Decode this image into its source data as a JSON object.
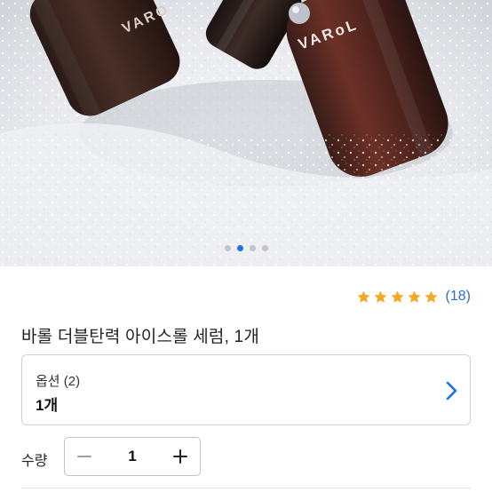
{
  "hero": {
    "brand_left": "VARO",
    "brand_right": "VARoL",
    "carousel": {
      "total": 4,
      "active_index": 1
    }
  },
  "rating": {
    "stars": 5,
    "max_stars": 5,
    "count": "(18)",
    "star_color": "#f5a623"
  },
  "product": {
    "title": "바롤 더블탄력 아이스롤 세럼, 1개"
  },
  "option": {
    "label": "옵션 (2)",
    "value": "1개",
    "icon": "chevron-right-icon"
  },
  "quantity": {
    "label": "수량",
    "value": "1",
    "minus_icon": "minus-icon",
    "plus_icon": "plus-icon"
  },
  "colors": {
    "accent": "#1a73e8",
    "link": "#2a6fcf"
  }
}
